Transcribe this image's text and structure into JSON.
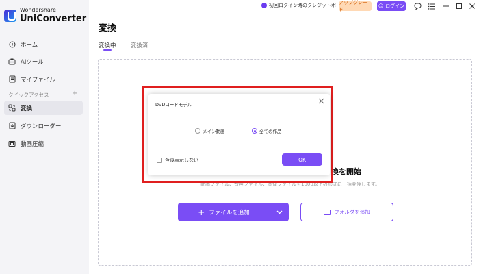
{
  "app": {
    "brand_small": "Wondershare",
    "brand_name": "UniConverter"
  },
  "sidebar": {
    "items": [
      {
        "label": "ホーム",
        "icon": "home-icon"
      },
      {
        "label": "AIツール",
        "icon": "ai-tools-icon"
      },
      {
        "label": "マイファイル",
        "icon": "my-files-icon"
      }
    ],
    "quick_access_label": "クイックアクセス",
    "quick_access_add": "+",
    "quick_items": [
      {
        "label": "変換",
        "icon": "convert-icon",
        "active": true
      },
      {
        "label": "ダウンローダー",
        "icon": "downloader-icon"
      },
      {
        "label": "動画圧縮",
        "icon": "compress-icon"
      }
    ]
  },
  "topbar": {
    "promo_text": "初回ログイン時のクレジットボーナス",
    "upgrade_label": "アップグレード",
    "login_label": "ログイン"
  },
  "main": {
    "title": "変換",
    "tabs": [
      {
        "label": "変換中",
        "active": true
      },
      {
        "label": "変換済",
        "active": false
      }
    ],
    "start_title": "換を開始",
    "start_desc": "動画ファイル、音声ファイル、画像ファイルを1000以上の形式に一括変換します。",
    "add_file_label": "ファイルを追加",
    "add_folder_label": "フォルダを追加"
  },
  "dialog": {
    "title": "DVDロードモデル",
    "options": [
      {
        "label": "メイン動画",
        "checked": false
      },
      {
        "label": "全ての作品",
        "checked": true
      }
    ],
    "dont_show_label": "今後表示しない",
    "ok_label": "OK"
  },
  "colors": {
    "accent": "#7a4df5",
    "highlight_frame": "#e01f1f",
    "upgrade_bg": "#ffd9b5"
  }
}
